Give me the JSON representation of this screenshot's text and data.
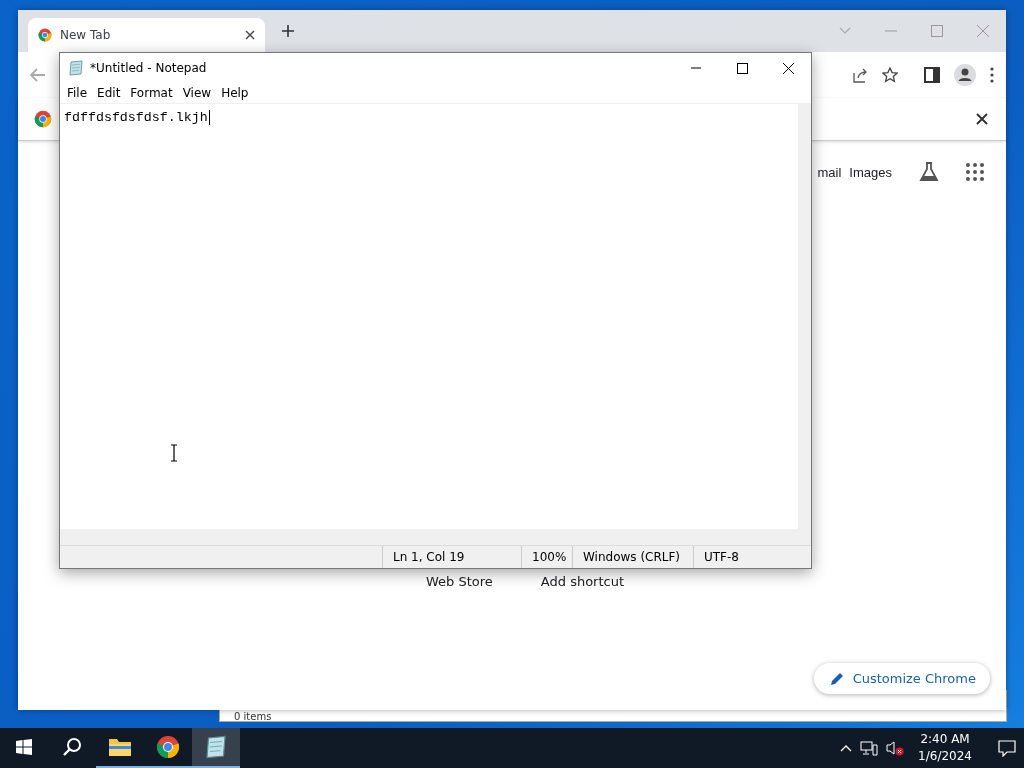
{
  "chrome": {
    "tabs": [
      {
        "title": "New Tab",
        "selected": true
      }
    ],
    "header_links": [
      "mail",
      "Images"
    ],
    "shortcuts": [
      "Web Store",
      "Add shortcut"
    ],
    "customize_button": "Customize Chrome"
  },
  "notepad": {
    "title": "*Untitled - Notepad",
    "menu": [
      "File",
      "Edit",
      "Format",
      "View",
      "Help"
    ],
    "text": "fdffdsfdsfdsf.lkjh",
    "status": [
      "Ln 1, Col 19",
      "100%",
      "Windows (CRLF)",
      "UTF-8"
    ]
  },
  "explorer": {
    "status": "0 items"
  },
  "taskbar": {
    "apps": [
      {
        "kind": "explorer",
        "selected": false
      },
      {
        "kind": "chrome",
        "selected": false
      },
      {
        "kind": "notepad",
        "selected": true
      }
    ],
    "time": "2:40 AM",
    "date": "1/6/2024"
  }
}
